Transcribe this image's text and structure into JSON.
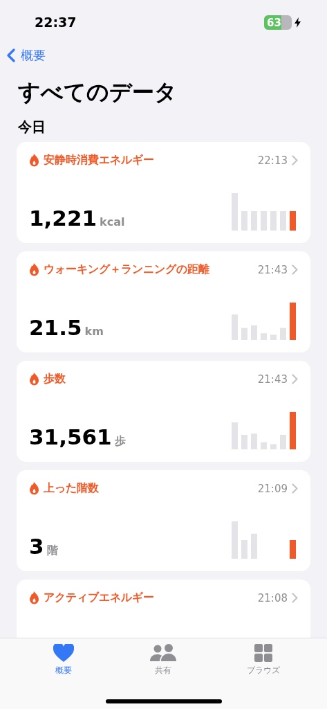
{
  "status_bar": {
    "time": "22:37",
    "battery": "63",
    "charging": true
  },
  "nav": {
    "back": "概要"
  },
  "title": "すべてのデータ",
  "section": "今日",
  "cards": [
    {
      "title": "安静時消費エネルギー",
      "time": "22:13",
      "value": "1,221",
      "unit": "kcal"
    },
    {
      "title": "ウォーキング＋ランニングの距離",
      "time": "21:43",
      "value": "21.5",
      "unit": "km"
    },
    {
      "title": "歩数",
      "time": "21:43",
      "value": "31,561",
      "unit": "歩"
    },
    {
      "title": "上った階数",
      "time": "21:09",
      "value": "3",
      "unit": "階"
    },
    {
      "title": "アクティブエネルギー",
      "time": "21:08"
    }
  ],
  "tab_bar": [
    {
      "label": "概要",
      "selected": true
    },
    {
      "label": "共有",
      "selected": false
    },
    {
      "label": "ブラウズ",
      "selected": false
    }
  ]
}
